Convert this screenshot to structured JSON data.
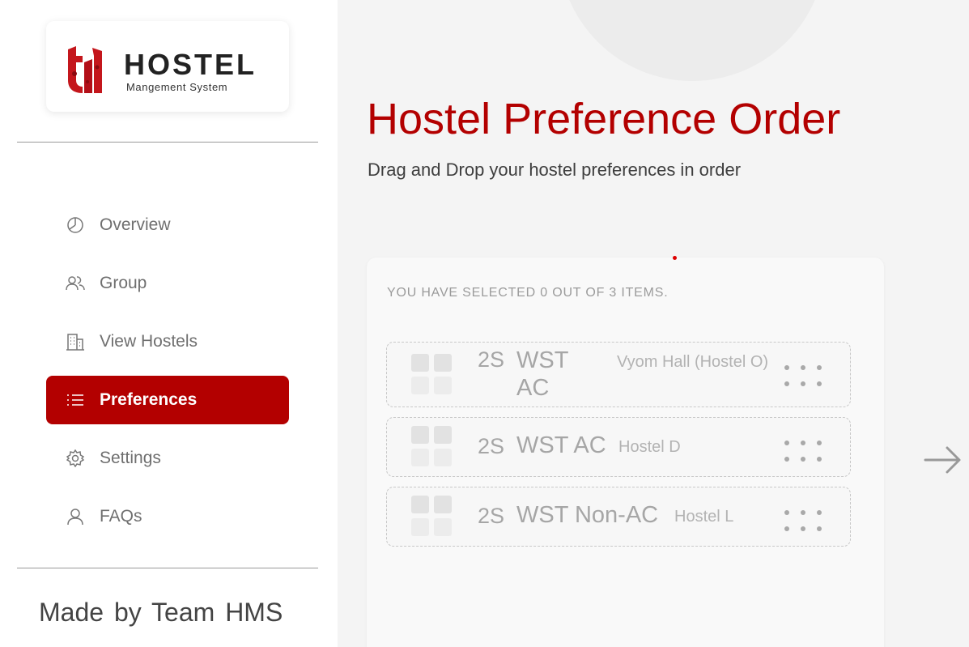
{
  "brand": {
    "logo_mark": "ti",
    "title": "HOSTEL",
    "subtitle": "Mangement System",
    "colors": {
      "primary": "#b30000",
      "logo_red": "#c4161c"
    }
  },
  "nav": {
    "items": [
      {
        "label": "Overview",
        "icon": "pie-chart-icon",
        "active": false
      },
      {
        "label": "Group",
        "icon": "users-icon",
        "active": false
      },
      {
        "label": "View Hostels",
        "icon": "building-icon",
        "active": false
      },
      {
        "label": "Preferences",
        "icon": "list-icon",
        "active": true
      },
      {
        "label": "Settings",
        "icon": "gear-icon",
        "active": false
      },
      {
        "label": "FAQs",
        "icon": "user-icon",
        "active": false
      }
    ]
  },
  "footer": {
    "made_by": "Made by  Team HMS"
  },
  "main": {
    "title": "Hostel Preference Order",
    "subtitle": "Drag and Drop your hostel preferences in order",
    "selection_status": "YOU HAVE SELECTED 0 OUT OF 3 ITEMS.",
    "preferences": [
      {
        "code": "2S",
        "type": "WST AC",
        "hostel": "Vyom Hall (Hostel O)"
      },
      {
        "code": "2S",
        "type": "WST AC",
        "hostel": "Hostel D"
      },
      {
        "code": "2S",
        "type": "WST Non-AC",
        "hostel": "Hostel L"
      }
    ],
    "next_icon": "arrow-right-icon"
  }
}
